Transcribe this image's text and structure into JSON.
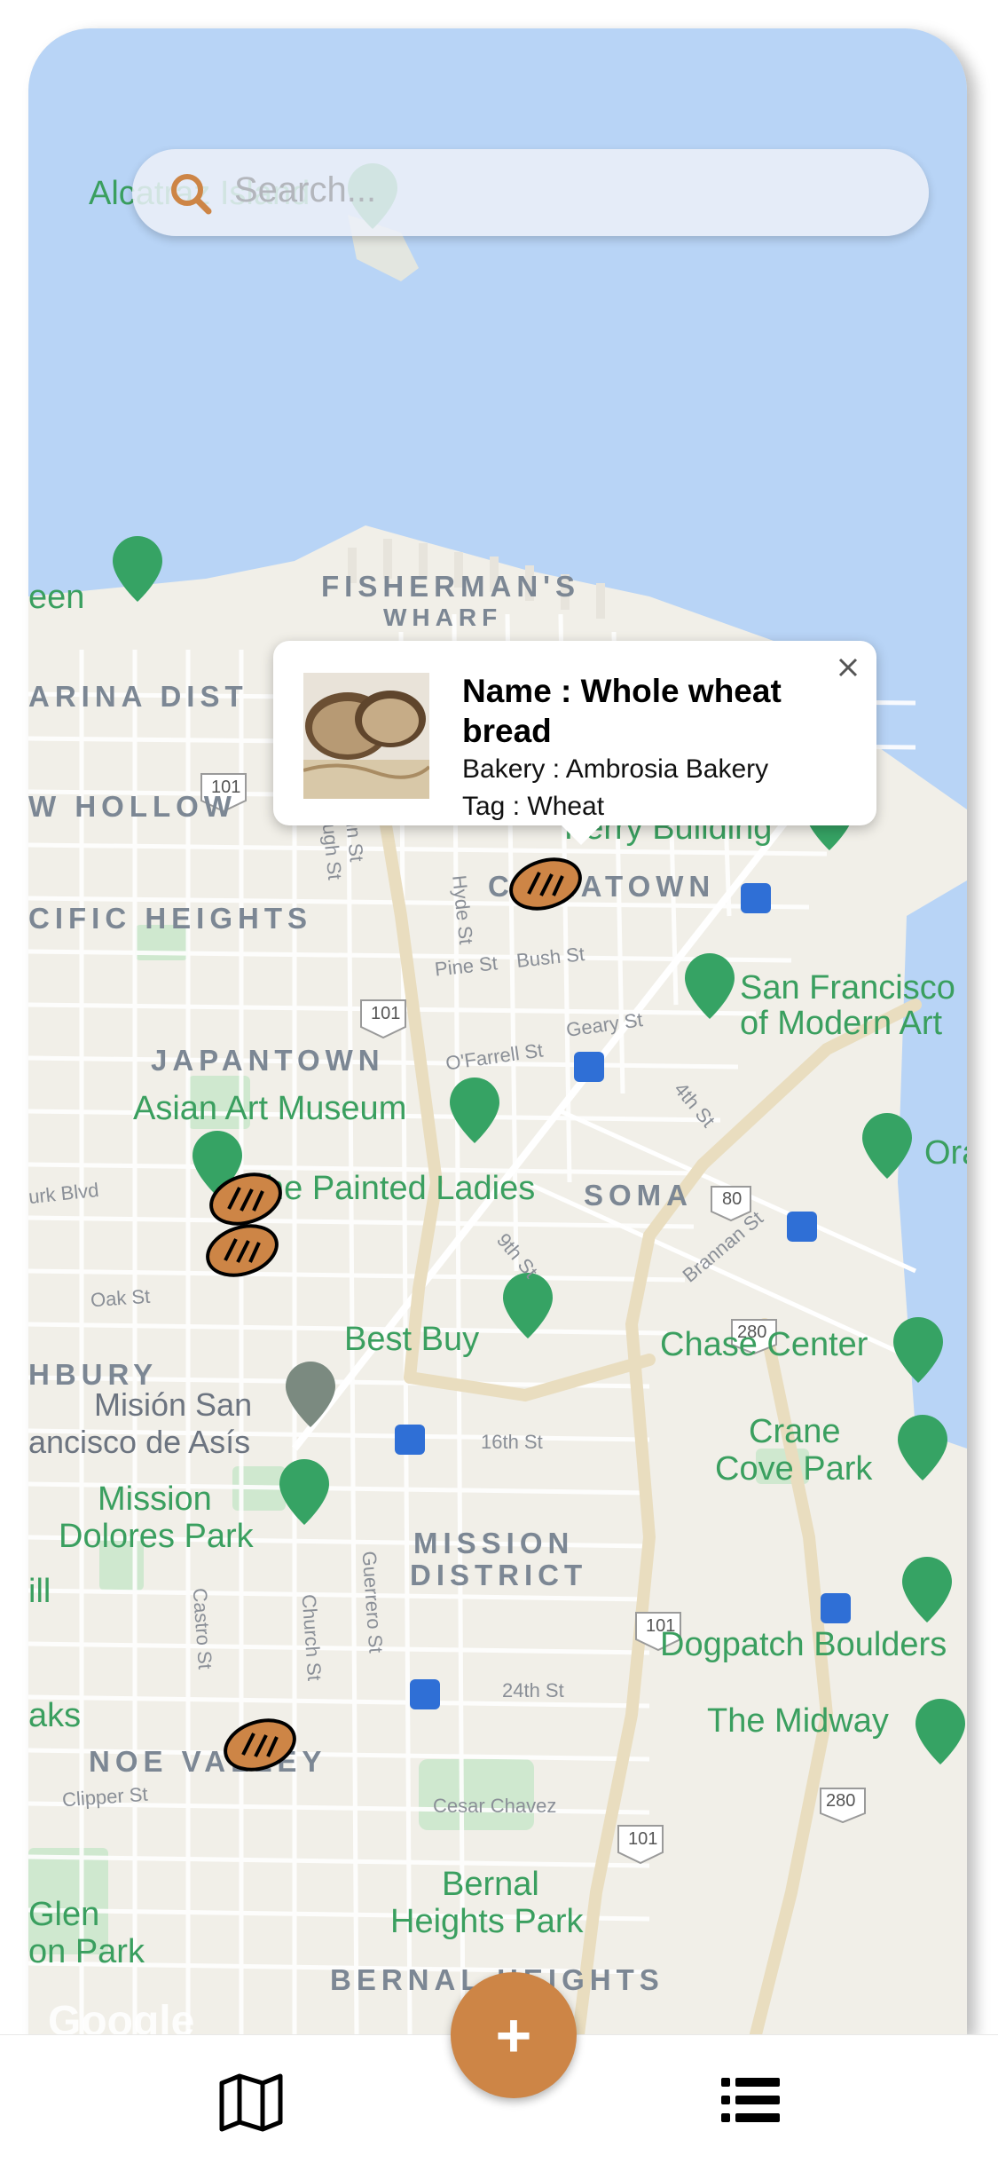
{
  "search": {
    "placeholder": "Search..."
  },
  "map": {
    "labels": {
      "alcatraz": "Alcatraz Island",
      "fishermans_wharf_1": "FISHERMAN'S",
      "fishermans_wharf_2": "WHARF",
      "marina": "ARINA DIST",
      "cow_hollow": "W HOLLOW",
      "pacific_heights": "CIFIC HEIGHTS",
      "chinatown": "CHINATOWN",
      "japantown": "JAPANTOWN",
      "asian_art": "Asian Art Museum",
      "painted_ladies": "he Painted Ladies",
      "soma": "SOMA",
      "best_buy": "Best Buy",
      "chase_center": "Chase Center",
      "haight": "HBURY",
      "mision_1": "Misión San",
      "mision_2": "ancisco de Asís",
      "mission_dolores_1": "Mission",
      "mission_dolores_2": "Dolores Park",
      "mission_district_1": "MISSION",
      "mission_district_2": "DISTRICT",
      "crane_1": "Crane",
      "crane_2": "Cove Park",
      "dogpatch": "Dogpatch Boulders",
      "the_midway": "The Midway",
      "noe_valley": "NOE VALLEY",
      "bernal_1": "Bernal",
      "bernal_2": "Heights Park",
      "bernal_heights": "BERNAL HEIGHTS",
      "glen_1": "Glen",
      "glen_2": "on Park",
      "ferry_building": "Ferry Building",
      "sfmoma_1": "San Francisco",
      "sfmoma_2": "of Modern Art",
      "oracle": "Ora",
      "een": "een",
      "ill": "ill",
      "aks": "aks",
      "pine_st": "Pine St",
      "bush_st": "Bush St",
      "geary_st": "Geary St",
      "ofarrell_st": "O'Farrell St",
      "fourth_st": "4th St",
      "brannan_st": "Brannan St",
      "ninth_st": "9th St",
      "sixteenth_st": "16th St",
      "twentyfourth_st": "24th St",
      "oak_st": "Oak St",
      "hyde_st": "Hyde St",
      "gough_st": "Gough St",
      "franklin_st": "nklin St",
      "castro_st": "Castro St",
      "church_st": "Church St",
      "guerrero_st": "Guerrero St",
      "clipper_st": "Clipper St",
      "cesar_chavez": "Cesar Chavez",
      "turk_blvd": "urk Blvd",
      "hwy_101": "101",
      "hwy_80": "80",
      "hwy_280": "280",
      "google": "Google"
    }
  },
  "popup": {
    "name": "Name : Whole wheat bread",
    "bakery": "Bakery : Ambrosia Bakery",
    "tag": "Tag : Wheat"
  },
  "fab": {
    "label": "+"
  },
  "nav": {
    "map_icon": "map-icon",
    "list_icon": "list-icon"
  },
  "colors": {
    "accent": "#cd8546",
    "water": "#b8d4f6",
    "land": "#f1efe8",
    "park": "#cfe8cf",
    "highway": "#e9ddbf"
  }
}
